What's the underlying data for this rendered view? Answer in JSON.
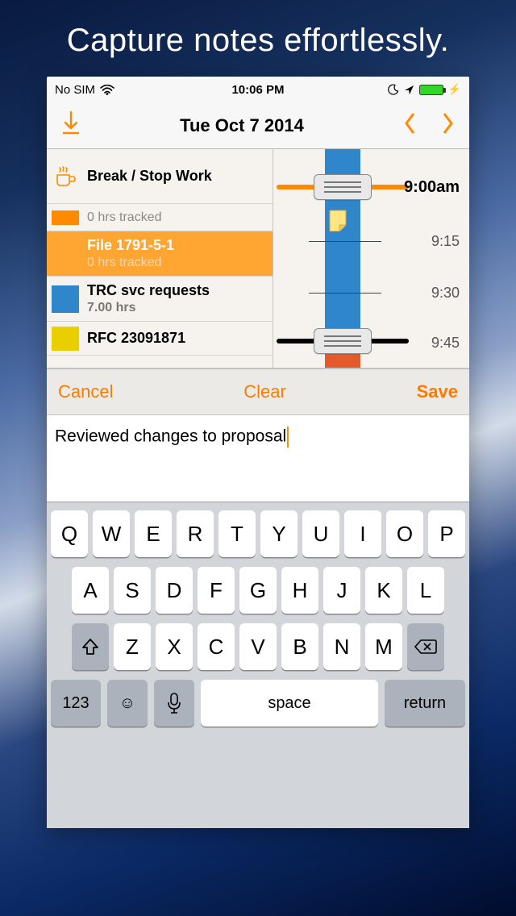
{
  "hero": "Capture notes effortlessly.",
  "status": {
    "carrier": "No SIM",
    "time": "10:06 PM"
  },
  "nav": {
    "title": "Tue Oct 7 2014"
  },
  "list": {
    "break_label": "Break / Stop Work",
    "tracked_small": "0 hrs tracked",
    "items": [
      {
        "name": "File 1791-5-1",
        "sub": "0 hrs tracked",
        "color": "#ffa531"
      },
      {
        "name": "TRC svc requests",
        "sub": "7.00 hrs",
        "color": "#2f86cb"
      },
      {
        "name": "RFC 23091871",
        "sub": "",
        "color": "#e9cf00"
      }
    ]
  },
  "timeline": {
    "labels": [
      "9:00am",
      "9:15",
      "9:30",
      "9:45"
    ]
  },
  "editor": {
    "cancel": "Cancel",
    "clear": "Clear",
    "save": "Save",
    "text": "Reviewed changes to proposal"
  },
  "keyboard": {
    "r1": [
      "Q",
      "W",
      "E",
      "R",
      "T",
      "Y",
      "U",
      "I",
      "O",
      "P"
    ],
    "r2": [
      "A",
      "S",
      "D",
      "F",
      "G",
      "H",
      "J",
      "K",
      "L"
    ],
    "r3": [
      "Z",
      "X",
      "C",
      "V",
      "B",
      "N",
      "M"
    ],
    "k123": "123",
    "space": "space",
    "ret": "return"
  }
}
